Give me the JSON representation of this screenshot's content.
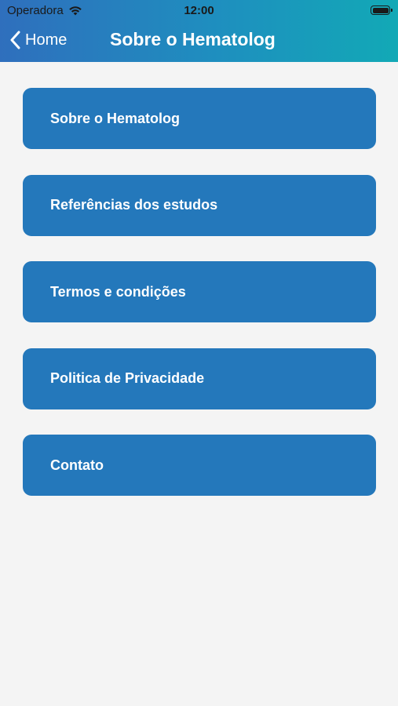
{
  "status_bar": {
    "carrier": "Operadora",
    "time": "12:00"
  },
  "nav": {
    "back_label": "Home",
    "title": "Sobre o Hematolog"
  },
  "menu": {
    "items": [
      {
        "label": "Sobre o Hematolog"
      },
      {
        "label": "Referências dos estudos"
      },
      {
        "label": "Termos e condições"
      },
      {
        "label": "Politica de Privacidade"
      },
      {
        "label": "Contato"
      }
    ]
  },
  "colors": {
    "header_gradient_start": "#2f6fbd",
    "header_gradient_end": "#12a9b6",
    "menu_button": "#2478bb",
    "background": "#f4f4f4"
  }
}
